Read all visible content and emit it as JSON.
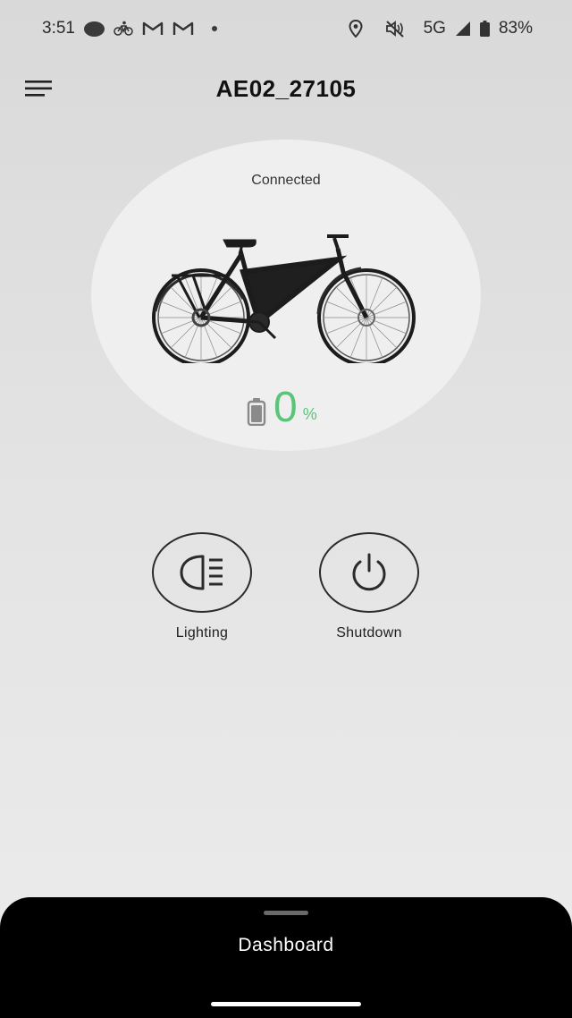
{
  "status_bar": {
    "time": "3:51",
    "network": "5G",
    "battery": "83%",
    "icons": [
      "circle-notification-icon",
      "bike-notification-icon",
      "gmail-icon",
      "gmail-icon",
      "dot-icon",
      "location-icon",
      "mute-icon",
      "signal-icon",
      "battery-icon"
    ]
  },
  "header": {
    "title": "AE02_27105",
    "menu_icon": "hamburger-menu-icon"
  },
  "device": {
    "connection_status": "Connected",
    "battery_percent": "0",
    "battery_unit": "%",
    "battery_color": "#5cc479"
  },
  "controls": [
    {
      "label": "Lighting",
      "icon": "headlight-icon"
    },
    {
      "label": "Shutdown",
      "icon": "power-icon"
    }
  ],
  "bottom_sheet": {
    "title": "Dashboard"
  }
}
